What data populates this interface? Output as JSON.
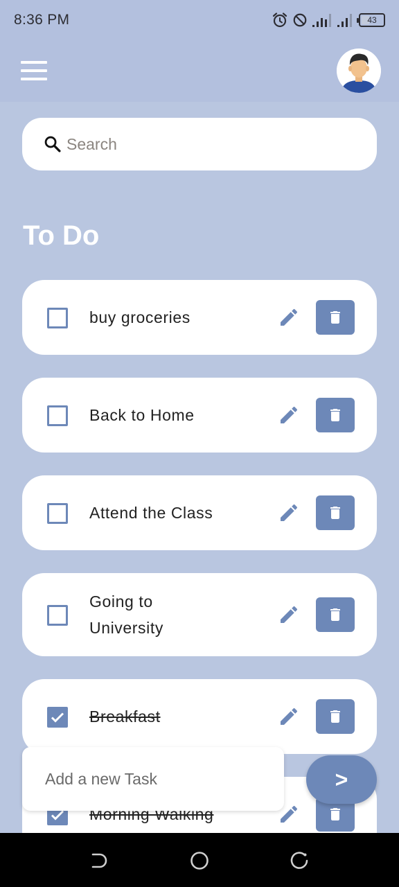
{
  "status_bar": {
    "time": "8:36 PM",
    "battery_level": "43",
    "icons": [
      "alarm-icon",
      "do-not-disturb-icon",
      "signal-icon",
      "signal-icon",
      "battery-icon"
    ]
  },
  "app_bar": {
    "menu_icon": "hamburger-menu-icon",
    "avatar": "user-avatar"
  },
  "search": {
    "placeholder": "Search",
    "value": ""
  },
  "section_title": "To Do",
  "todos": [
    {
      "text": "buy groceries",
      "done": false
    },
    {
      "text": "Back to Home",
      "done": false
    },
    {
      "text": "Attend the Class",
      "done": false
    },
    {
      "text": "Going to University",
      "done": false
    },
    {
      "text": "Breakfast",
      "done": true
    },
    {
      "text": "Morning Walking",
      "done": true
    }
  ],
  "add_task": {
    "placeholder": "Add a new Task",
    "value": "",
    "submit_label": ">"
  },
  "colors": {
    "background": "#b9c6e0",
    "app_bar": "#b3c0de",
    "accent": "#6d88b8",
    "card": "#ffffff",
    "nav_bar": "#000000"
  }
}
